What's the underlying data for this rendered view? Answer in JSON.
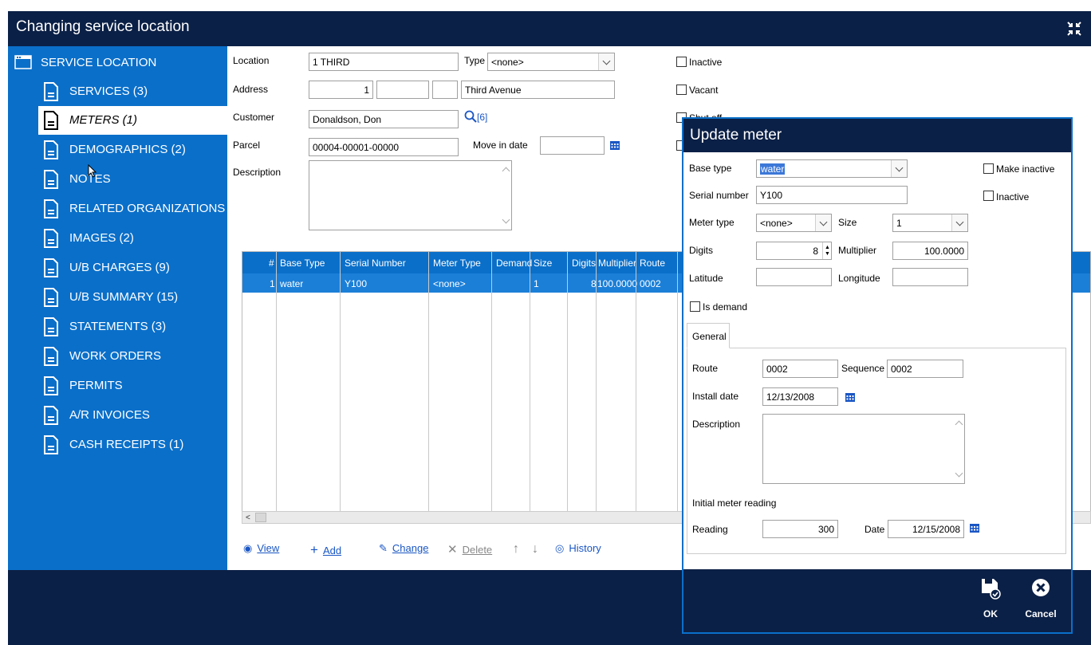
{
  "window": {
    "title": "Changing service location"
  },
  "sidebar": {
    "items": [
      {
        "label": "SERVICE LOCATION"
      },
      {
        "label": "SERVICES (3)"
      },
      {
        "label": "METERS (1)"
      },
      {
        "label": "DEMOGRAPHICS (2)"
      },
      {
        "label": "NOTES"
      },
      {
        "label": "RELATED ORGANIZATIONS"
      },
      {
        "label": "IMAGES (2)"
      },
      {
        "label": "U/B CHARGES (9)"
      },
      {
        "label": "U/B SUMMARY (15)"
      },
      {
        "label": "STATEMENTS (3)"
      },
      {
        "label": "WORK ORDERS"
      },
      {
        "label": "PERMITS"
      },
      {
        "label": "A/R INVOICES"
      },
      {
        "label": "CASH RECEIPTS (1)"
      }
    ]
  },
  "form": {
    "location_label": "Location",
    "location_value": "1 THIRD",
    "type_label": "Type",
    "type_value": "<none>",
    "address_label": "Address",
    "address_number": "1",
    "address_street": "Third Avenue",
    "customer_label": "Customer",
    "customer_value": "Donaldson, Don",
    "customer_count": "[6]",
    "parcel_label": "Parcel",
    "parcel_value": "00004-00001-00000",
    "move_in_label": "Move in date",
    "move_in_value": "",
    "description_label": "Description",
    "inactive_label": "Inactive",
    "vacant_label": "Vacant",
    "shut_off_label": "Shut off"
  },
  "grid": {
    "columns": [
      "#",
      "Base Type",
      "Serial Number",
      "Meter Type",
      "Demand",
      "Size",
      "Digits",
      "Multiplier",
      "Route"
    ],
    "rows": [
      [
        "1",
        "water",
        "Y100",
        "<none>",
        "",
        "1",
        "8",
        "100.0000",
        "0002"
      ]
    ]
  },
  "toolbar": {
    "view": "View",
    "add": "Add",
    "change": "Change",
    "delete": "Delete",
    "history": "History"
  },
  "dialog": {
    "title": "Update meter",
    "base_type_label": "Base type",
    "base_type_value": "water",
    "make_inactive_label": "Make inactive",
    "inactive_label": "Inactive",
    "serial_label": "Serial number",
    "serial_value": "Y100",
    "meter_type_label": "Meter type",
    "meter_type_value": "<none>",
    "size_label": "Size",
    "size_value": "1",
    "digits_label": "Digits",
    "digits_value": "8",
    "multiplier_label": "Multiplier",
    "multiplier_value": "100.0000",
    "latitude_label": "Latitude",
    "latitude_value": "",
    "longitude_label": "Longitude",
    "longitude_value": "",
    "is_demand_label": "Is demand",
    "tab_general": "General",
    "route_label": "Route",
    "route_value": "0002",
    "sequence_label": "Sequence",
    "sequence_value": "0002",
    "install_date_label": "Install date",
    "install_date_value": "12/13/2008",
    "description_label": "Description",
    "initial_reading_label": "Initial meter reading",
    "reading_label": "Reading",
    "reading_value": "300",
    "date_label": "Date",
    "date_value": "12/15/2008",
    "ok_label": "OK",
    "cancel_label": "Cancel"
  },
  "colors": {
    "navy": "#0b2046",
    "sidebar_blue": "#0a6fc9",
    "row_selected": "#1b7fd8",
    "link_blue": "#1a56c4"
  }
}
